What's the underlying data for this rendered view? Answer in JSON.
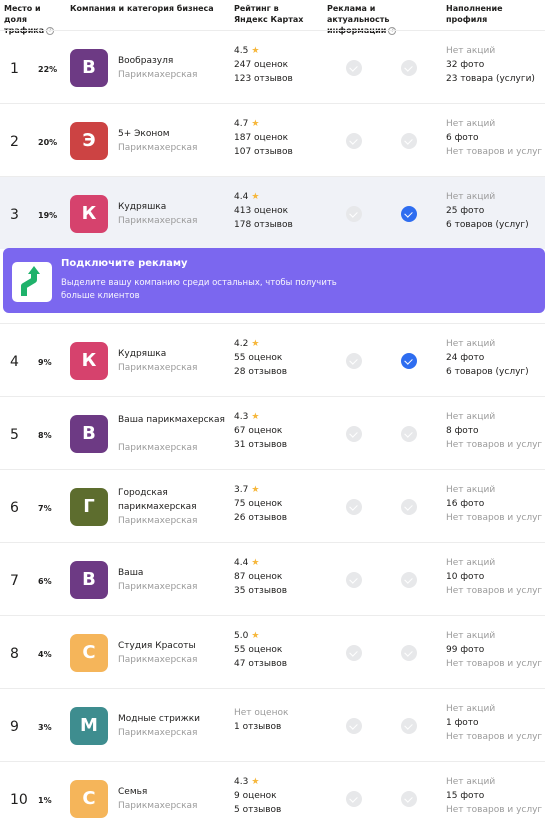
{
  "header": {
    "col_rank": "Место и доля трафика",
    "col_company": "Компания и категория бизнеса",
    "col_rating": "Рейтинг в Яндекс Картах",
    "col_ads": "Реклама и актуальность информации",
    "col_profile": "Наполнение профиля"
  },
  "banner": {
    "title": "Подключите рекламу",
    "text": "Выделите вашу компанию среди остальных, чтобы получить больше клиентов"
  },
  "rows": [
    {
      "rank": "1",
      "share": "22%",
      "letter": "В",
      "color": "#6d3a84",
      "name": "Вообразуля",
      "category": "Парикмахерская",
      "rating": "4.5",
      "ratings_count": "247 оценок",
      "reviews": "123 отзывов",
      "ad": false,
      "actual": false,
      "promo": "Нет акций",
      "photos": "32 фото",
      "goods": "23 товара (услуги)",
      "goods_gray": false
    },
    {
      "rank": "2",
      "share": "20%",
      "letter": "Э",
      "color": "#cc4343",
      "name": "5+ Эконом",
      "category": "Парикмахерская",
      "rating": "4.7",
      "ratings_count": "187 оценок",
      "reviews": "107 отзывов",
      "ad": false,
      "actual": false,
      "promo": "Нет акций",
      "photos": "6 фото",
      "goods": "Нет товаров и услуг",
      "goods_gray": true
    },
    {
      "rank": "3",
      "share": "19%",
      "letter": "К",
      "color": "#d6426d",
      "name": "Кудряшка",
      "category": "Парикмахерская",
      "rating": "4.4",
      "ratings_count": "413 оценок",
      "reviews": "178 отзывов",
      "ad": false,
      "actual": true,
      "promo": "Нет акций",
      "photos": "25 фото",
      "goods": "6 товаров (услуг)",
      "goods_gray": false
    },
    {
      "rank": "4",
      "share": "9%",
      "letter": "К",
      "color": "#d6426d",
      "name": "Кудряшка",
      "category": "Парикмахерская",
      "rating": "4.2",
      "ratings_count": "55 оценок",
      "reviews": "28 отзывов",
      "ad": false,
      "actual": true,
      "promo": "Нет акций",
      "photos": "24 фото",
      "goods": "6 товаров (услуг)",
      "goods_gray": false
    },
    {
      "rank": "5",
      "share": "8%",
      "letter": "В",
      "color": "#6d3a84",
      "name": "Ваша парикмахерская",
      "category": "Парикмахерская",
      "rating": "4.3",
      "ratings_count": "67 оценок",
      "reviews": "31 отзывов",
      "ad": false,
      "actual": false,
      "promo": "Нет акций",
      "photos": "8 фото",
      "goods": "Нет товаров и услуг",
      "goods_gray": true
    },
    {
      "rank": "6",
      "share": "7%",
      "letter": "Г",
      "color": "#5d6d2e",
      "name": "Городская парикмахерская",
      "category": "Парикмахерская",
      "rating": "3.7",
      "ratings_count": "75 оценок",
      "reviews": "26 отзывов",
      "ad": false,
      "actual": false,
      "promo": "Нет акций",
      "photos": "16 фото",
      "goods": "Нет товаров и услуг",
      "goods_gray": true
    },
    {
      "rank": "7",
      "share": "6%",
      "letter": "В",
      "color": "#6d3a84",
      "name": "Ваша",
      "category": "Парикмахерская",
      "rating": "4.4",
      "ratings_count": "87 оценок",
      "reviews": "35 отзывов",
      "ad": false,
      "actual": false,
      "promo": "Нет акций",
      "photos": "10 фото",
      "goods": "Нет товаров и услуг",
      "goods_gray": true
    },
    {
      "rank": "8",
      "share": "4%",
      "letter": "С",
      "color": "#f5b55a",
      "name": "Студия Красоты",
      "category": "Парикмахерская",
      "rating": "5.0",
      "ratings_count": "55 оценок",
      "reviews": "47 отзывов",
      "ad": false,
      "actual": false,
      "promo": "Нет акций",
      "photos": "99 фото",
      "goods": "Нет товаров и услуг",
      "goods_gray": true
    },
    {
      "rank": "9",
      "share": "3%",
      "letter": "М",
      "color": "#3e8d8f",
      "name": "Модные стрижки",
      "category": "Парикмахерская",
      "rating": "Нет оценок",
      "ratings_count": "",
      "reviews": "1 отзывов",
      "ad": false,
      "actual": false,
      "promo": "Нет акций",
      "photos": "1 фото",
      "goods": "Нет товаров и услуг",
      "goods_gray": true
    },
    {
      "rank": "10",
      "share": "1%",
      "letter": "С",
      "color": "#f5b55a",
      "name": "Семья",
      "category": "Парикмахерская",
      "rating": "4.3",
      "ratings_count": "9 оценок",
      "reviews": "5 отзывов",
      "ad": false,
      "actual": false,
      "promo": "Нет акций",
      "photos": "15 фото",
      "goods": "Нет товаров и услуг",
      "goods_gray": true
    }
  ]
}
